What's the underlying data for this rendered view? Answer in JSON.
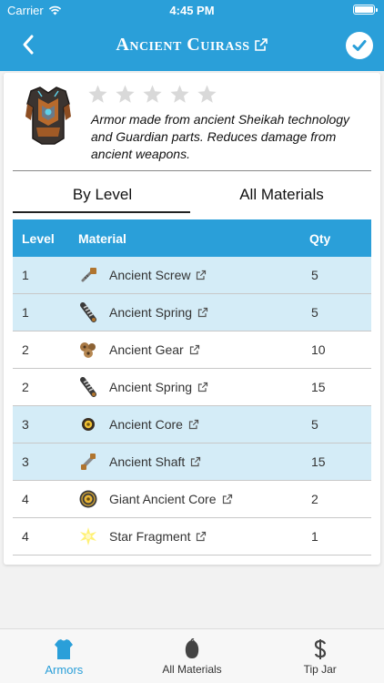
{
  "status_bar": {
    "carrier": "Carrier",
    "time": "4:45 PM"
  },
  "header": {
    "title": "Ancient Cuirass"
  },
  "item": {
    "rating": 0,
    "max_rating": 5,
    "description": "Armor made from ancient Sheikah technology and Guardian parts. Reduces damage from ancient weapons."
  },
  "tabs": [
    {
      "label": "By Level",
      "active": true
    },
    {
      "label": "All Materials",
      "active": false
    }
  ],
  "table": {
    "headers": {
      "level": "Level",
      "material": "Material",
      "qty": "Qty"
    },
    "rows": [
      {
        "level": "1",
        "material": "Ancient Screw",
        "qty": "5",
        "icon": "screw-icon",
        "highlight": true
      },
      {
        "level": "1",
        "material": "Ancient Spring",
        "qty": "5",
        "icon": "spring-icon",
        "highlight": true
      },
      {
        "level": "2",
        "material": "Ancient Gear",
        "qty": "10",
        "icon": "gear-icon",
        "highlight": false
      },
      {
        "level": "2",
        "material": "Ancient Spring",
        "qty": "15",
        "icon": "spring-icon",
        "highlight": false
      },
      {
        "level": "3",
        "material": "Ancient Core",
        "qty": "5",
        "icon": "core-icon",
        "highlight": true
      },
      {
        "level": "3",
        "material": "Ancient Shaft",
        "qty": "15",
        "icon": "shaft-icon",
        "highlight": true
      },
      {
        "level": "4",
        "material": "Giant Ancient Core",
        "qty": "2",
        "icon": "giant-core-icon",
        "highlight": false
      },
      {
        "level": "4",
        "material": "Star Fragment",
        "qty": "1",
        "icon": "star-fragment-icon",
        "highlight": false
      }
    ]
  },
  "tabbar": [
    {
      "label": "Armors",
      "icon": "armor-icon",
      "active": true
    },
    {
      "label": "All Materials",
      "icon": "material-icon",
      "active": false
    },
    {
      "label": "Tip Jar",
      "icon": "dollar-icon",
      "active": false
    }
  ],
  "colors": {
    "accent": "#2a9fd9",
    "highlight_row": "#d4ecf7",
    "star_empty": "#d9d9d9"
  }
}
